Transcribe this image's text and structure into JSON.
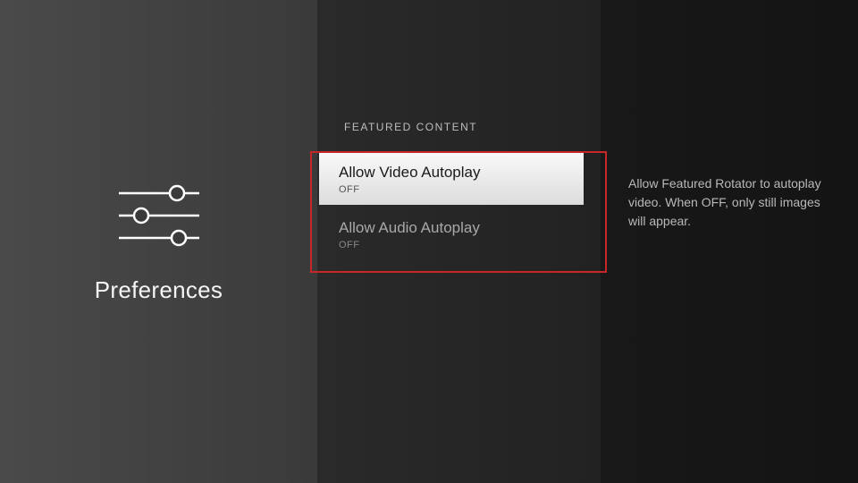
{
  "left": {
    "title": "Preferences"
  },
  "mid": {
    "section_header": "FEATURED CONTENT",
    "options": [
      {
        "label": "Allow Video Autoplay",
        "value": "OFF"
      },
      {
        "label": "Allow Audio Autoplay",
        "value": "OFF"
      }
    ]
  },
  "right": {
    "help_text": "Allow Featured Rotator to autoplay video. When OFF, only still images will appear."
  }
}
